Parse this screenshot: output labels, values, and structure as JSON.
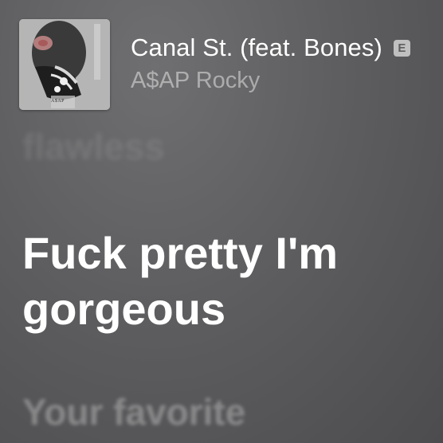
{
  "now_playing": {
    "song_title": "Canal St. (feat. Bones)",
    "explicit_badge": "E",
    "artist": "A$AP Rocky",
    "album_art_text": "A$AP"
  },
  "lyrics": {
    "previous_line": "flawless",
    "current_line": "Fuck pretty I'm gorgeous",
    "next_line": "Your favorite"
  },
  "colors": {
    "background": "#5e5e60",
    "title": "#ffffff",
    "artist": "#a3a3a4",
    "current_lyric": "#ffffff"
  }
}
